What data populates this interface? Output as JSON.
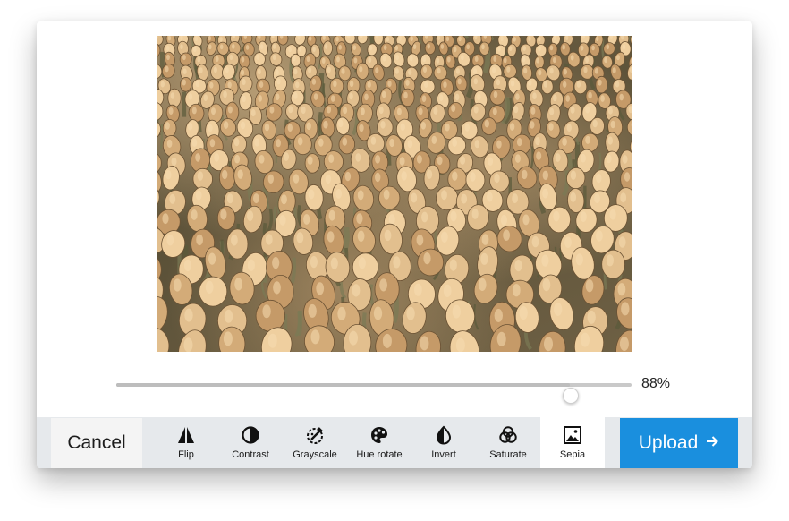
{
  "editor": {
    "image": {
      "subject": "tulip-field",
      "filter": "Sepia"
    },
    "slider": {
      "value": 0.88,
      "value_label": "88%"
    },
    "toolbar": {
      "cancel_label": "Cancel",
      "upload_label": "Upload",
      "upload_icon": "arrow-right-icon",
      "tools": [
        {
          "label": "Flip",
          "icon": "flip-icon"
        },
        {
          "label": "Contrast",
          "icon": "contrast-icon"
        },
        {
          "label": "Grayscale",
          "icon": "grayscale-icon"
        },
        {
          "label": "Hue rotate",
          "icon": "palette-icon"
        },
        {
          "label": "Invert",
          "icon": "invert-icon"
        },
        {
          "label": "Saturate",
          "icon": "saturate-icon"
        },
        {
          "label": "Sepia",
          "icon": "image-icon",
          "active": true
        }
      ]
    },
    "colors": {
      "toolbar_bg": "#e6e9ec",
      "upload_bg": "#1a8fde",
      "active_tool_bg": "#ffffff"
    }
  }
}
